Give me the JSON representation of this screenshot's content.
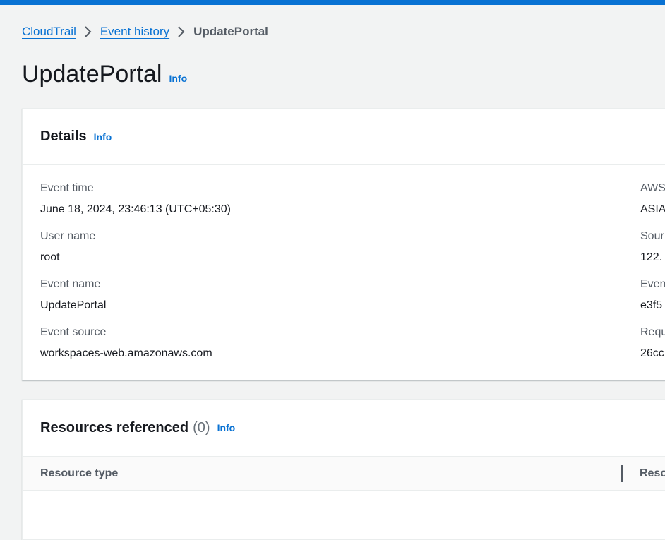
{
  "colors": {
    "accent": "#0972d3",
    "page_bg": "#f2f3f3",
    "text": "#16191f",
    "muted": "#545b64"
  },
  "breadcrumb": {
    "items": [
      {
        "label": "CloudTrail"
      },
      {
        "label": "Event history"
      }
    ],
    "current": "UpdatePortal"
  },
  "page": {
    "title": "UpdatePortal",
    "info": "Info"
  },
  "details": {
    "title": "Details",
    "info": "Info",
    "left": [
      {
        "label": "Event time",
        "value": "June 18, 2024, 23:46:13 (UTC+05:30)"
      },
      {
        "label": "User name",
        "value": "root"
      },
      {
        "label": "Event name",
        "value": "UpdatePortal"
      },
      {
        "label": "Event source",
        "value": "workspaces-web.amazonaws.com"
      }
    ],
    "right": [
      {
        "label": "AWS",
        "value": "ASIA"
      },
      {
        "label": "Sour",
        "value": "122."
      },
      {
        "label": "Even",
        "value": "e3f5"
      },
      {
        "label": "Requ",
        "value": "26cc"
      }
    ]
  },
  "resources": {
    "title": "Resources referenced",
    "count": "(0)",
    "info": "Info",
    "columns": [
      "Resource type",
      "Reso"
    ]
  }
}
